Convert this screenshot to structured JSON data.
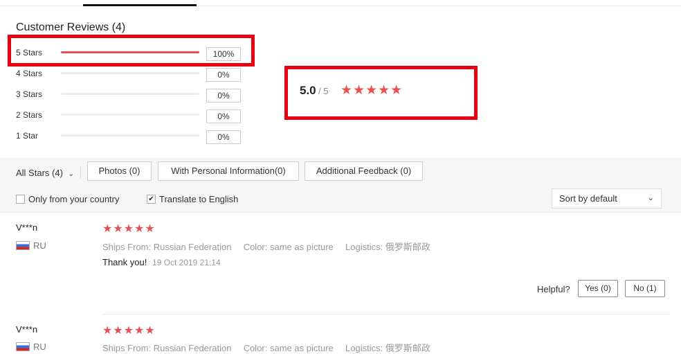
{
  "header": {
    "title": "Customer Reviews (4)"
  },
  "distribution": [
    {
      "label": "5 Stars",
      "percent_text": "100%",
      "percent": 100
    },
    {
      "label": "4 Stars",
      "percent_text": "0%",
      "percent": 0
    },
    {
      "label": "3 Stars",
      "percent_text": "0%",
      "percent": 0
    },
    {
      "label": "2 Stars",
      "percent_text": "0%",
      "percent": 0
    },
    {
      "label": "1 Star",
      "percent_text": "0%",
      "percent": 0
    }
  ],
  "average": {
    "score": "5.0",
    "denominator": "/ 5",
    "stars": "★★★★★"
  },
  "filters": {
    "all_stars": "All Stars (4)",
    "chips": [
      "Photos (0)",
      "With Personal Information(0)",
      "Additional Feedback (0)"
    ],
    "only_country": {
      "label": "Only from your country",
      "checked": false
    },
    "translate": {
      "label": "Translate to English",
      "checked": true
    },
    "sort": "Sort by default"
  },
  "reviews": [
    {
      "name": "V***n",
      "country": "RU",
      "stars": "★★★★★",
      "ships_from_key": "Ships From:",
      "ships_from": "Russian Federation",
      "color_key": "Color:",
      "color": "same as picture",
      "logistics_key": "Logistics:",
      "logistics": "俄罗斯邮政",
      "text": "Thank you!",
      "date": "19 Oct 2019 21:14",
      "helpful": "Helpful?",
      "yes": "Yes (0)",
      "no": "No (1)"
    },
    {
      "name": "V***n",
      "country": "RU",
      "stars": "★★★★★",
      "ships_from_key": "Ships From:",
      "ships_from": "Russian Federation",
      "color_key": "Color:",
      "color": "same as picture",
      "logistics_key": "Logistics:",
      "logistics": "俄罗斯邮政"
    }
  ],
  "colors": {
    "accent": "#e8504f",
    "highlight": "#e60012"
  }
}
